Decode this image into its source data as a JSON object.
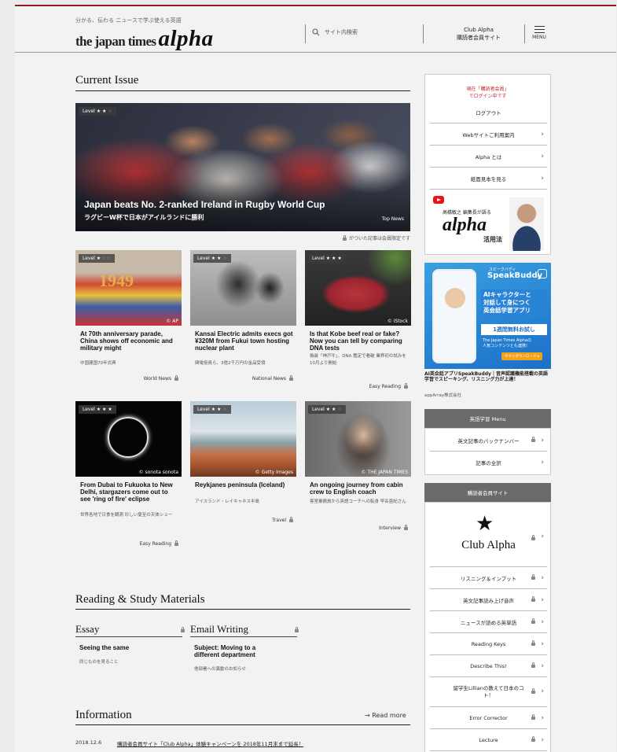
{
  "header": {
    "tagline": "分かる、伝わる ニュースで学ぶ使える英語",
    "logo_text": "the japan times",
    "logo_alpha": "alpha",
    "search_placeholder": "サイト内検索",
    "club_line1": "Club Alpha",
    "club_line2": "購読者会員サイト",
    "menu_label": "MENU"
  },
  "current_issue": {
    "heading": "Current Issue",
    "hero": {
      "level": "Level ★ ★",
      "level_dim": "☆",
      "title": "Japan beats No. 2-ranked Ireland in Rugby World Cup",
      "subtitle": "ラグビーW杯で日本がアイルランドに勝利",
      "category": "Top News"
    },
    "member_note": "がついた記事は会員限定です",
    "cards": [
      {
        "level": "Level ★",
        "level_dim": "☆☆",
        "credit": "© AP",
        "title": "At 70th anniversary parade, China shows off economic and military might",
        "sub": "中国建国70年式典",
        "category": "World News"
      },
      {
        "level": "Level ★ ★",
        "level_dim": "☆",
        "credit": "",
        "title": "Kansai Electric admits execs got ¥320M from Fukui town hosting nuclear plant",
        "sub": "関電役員ら、3億2千万円の金品受領",
        "category": "National News"
      },
      {
        "level": "Level ★ ★ ★",
        "level_dim": "",
        "credit": "© iStock",
        "title": "Is that Kobe beef real or fake? Now you can tell by comparing DNA tests",
        "sub": "偽装「神戸牛」、DNA 鑑定で看破 業界初の試みを10月より開始",
        "category": "Easy Reading"
      },
      {
        "level": "Level ★ ★ ★",
        "level_dim": "",
        "credit": "© sonota sonota",
        "title": "From Dubai to Fukuoka to New Delhi, stargazers come out to see 'ring of fire' eclipse",
        "sub": "世界各地で日食を観測 珍しい夏至の天体ショー",
        "category": "Easy Reading"
      },
      {
        "level": "Level ★ ★",
        "level_dim": "☆",
        "credit": "© Getty Images",
        "title": "Reykjanes peninsula (Iceland)",
        "sub": "アイスランド・レイキャネス半島",
        "category": "Travel"
      },
      {
        "level": "Level ★ ★",
        "level_dim": "☆",
        "credit": "© THE JAPAN TIMES",
        "title": "An ongoing journey from cabin crew to English coach",
        "sub": "客室乗務員から英語コーチへの転身 早名亜紀さん",
        "category": "Interview"
      }
    ]
  },
  "reading": {
    "heading": "Reading & Study Materials",
    "essay": {
      "heading": "Essay",
      "title": "Seeing the same",
      "sub": "同じものを見ること"
    },
    "email": {
      "heading": "Email Writing",
      "title": "Subject: Moving to a different department",
      "sub": "他部署への異動のお知らせ"
    }
  },
  "information": {
    "heading": "Information",
    "read_more": "→  Read more",
    "date": "2018.12.6",
    "link": "購読者会員サイト「Club Alpha」体験キャンペーンを 2018年11月末まで延長！"
  },
  "sidebar": {
    "login_line1": "現在「購読者会員」",
    "login_line2": "でログイン中です",
    "logout": "ログアウト",
    "items": [
      "Webサイトご利用案内",
      "Alpha とは",
      "紙面見本を見る"
    ],
    "promo_editor": "高橋敏之 編集長が語る",
    "promo_alpha": "alpha",
    "promo_usage": "活用法",
    "ad": {
      "brand_jp": "スピークバディ",
      "brand": "SpeakBuddy",
      "headline1": "AIキャラクターと",
      "headline2": "対話して身につく",
      "headline3": "英会話学習アプリ",
      "trial": "1週間無料お試し",
      "note1": "The Japan Times Alphaの",
      "note2": "人気コンテンツとも連携!",
      "download": "今すぐダウンロード ▸",
      "caption": "AI英会話アプリSpeakBuddy｜音声認識機能搭載の英語学習でスピーキング、リスニング力が上達！",
      "company": "appArray株式会社"
    },
    "menu_head": "英語学習 Menu",
    "menu_items": [
      "英文記事のバックナンバー",
      "記事の全訳"
    ],
    "member_head": "購読者会員サイト",
    "club_alpha": "Club Alpha",
    "member_items": [
      "リスニング＆インプット",
      "英文記事読み上げ音声",
      "ニュースが読める英単語",
      "Reading Keys",
      "Describe This!",
      "留学生Lillianの教えて日本のコト！",
      "Error Corrector",
      "Lecture"
    ]
  },
  "colors": {
    "accent": "#c0272d",
    "header_rule": "#8a1c24",
    "sidebar_head": "#6a6a6a"
  }
}
